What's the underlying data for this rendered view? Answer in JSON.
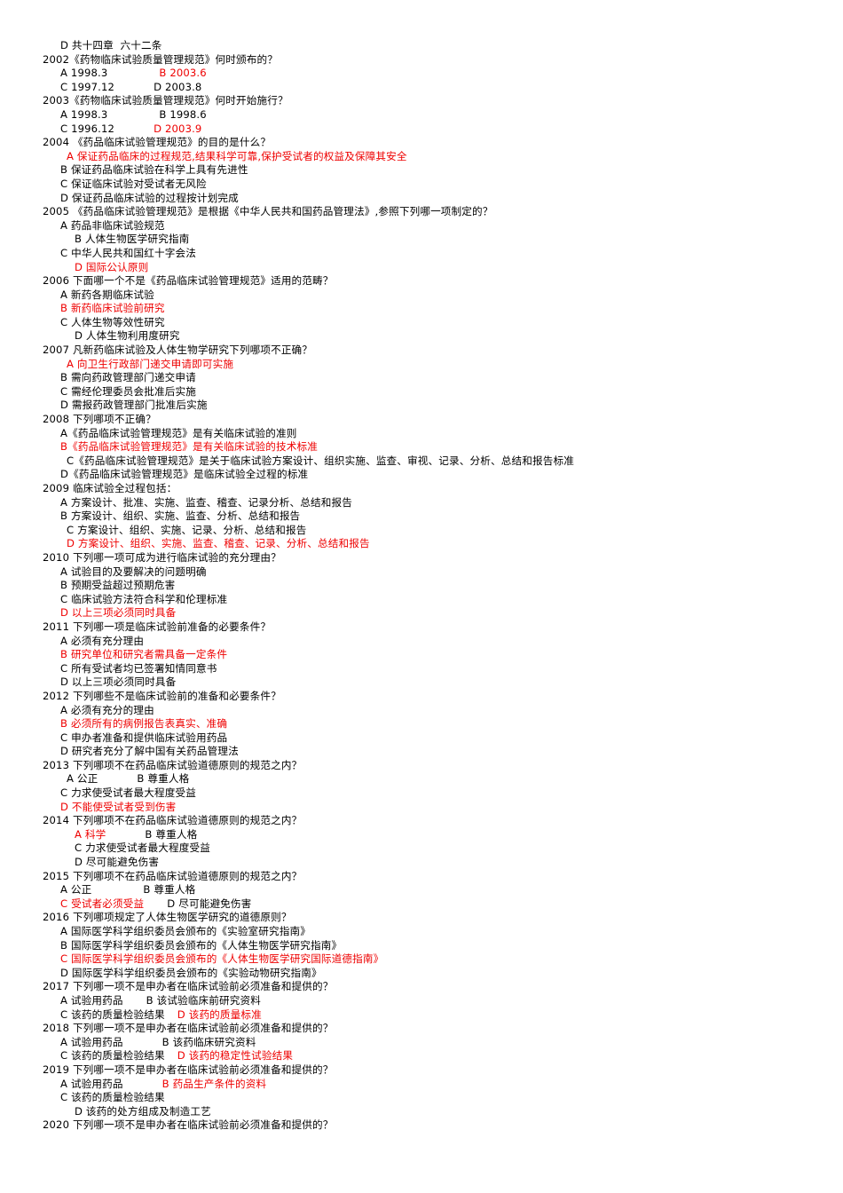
{
  "document": {
    "type": "exam-question-bank",
    "language": "zh-CN",
    "answer_color": "#ee0000",
    "text_color": "#000000",
    "background_color": "#ffffff"
  },
  "lines": [
    {
      "id": "l1",
      "indent": "i-a",
      "segments": [
        {
          "text": "D 共十四章  六十二条",
          "color": "black"
        }
      ]
    },
    {
      "id": "l2",
      "indent": "i-q",
      "segments": [
        {
          "text": "2002《药物临床试验质量管理规范》何时颁布的？",
          "color": "black"
        }
      ]
    },
    {
      "id": "l3",
      "indent": "i-a",
      "segments": [
        {
          "text": "A 1998.3",
          "color": "black"
        },
        {
          "gap": "gap-l"
        },
        {
          "text": "B 2003.6",
          "color": "red"
        }
      ]
    },
    {
      "id": "l4",
      "indent": "i-a",
      "segments": [
        {
          "text": "C 1997.12",
          "color": "black"
        },
        {
          "gap": "gap-m"
        },
        {
          "text": "D 2003.8",
          "color": "black"
        }
      ]
    },
    {
      "id": "l5",
      "indent": "i-q",
      "segments": [
        {
          "text": "2003《药物临床试验质量管理规范》何时开始施行？",
          "color": "black"
        }
      ]
    },
    {
      "id": "l6",
      "indent": "i-a",
      "segments": [
        {
          "text": "A 1998.3",
          "color": "black"
        },
        {
          "gap": "gap-l"
        },
        {
          "text": "B 1998.6",
          "color": "black"
        }
      ]
    },
    {
      "id": "l7",
      "indent": "i-a",
      "segments": [
        {
          "text": "C 1996.12",
          "color": "black"
        },
        {
          "gap": "gap-m"
        },
        {
          "text": "D 2003.9",
          "color": "red"
        }
      ]
    },
    {
      "id": "l8",
      "indent": "i-q",
      "segments": [
        {
          "text": "2004 《药品临床试验管理规范》的目的是什么？",
          "color": "black"
        }
      ]
    },
    {
      "id": "l9",
      "indent": "i-b",
      "segments": [
        {
          "text": "A 保证药品临床的过程规范,结果科学可靠,保护受试者的权益及保障其安全",
          "color": "red"
        }
      ]
    },
    {
      "id": "l10",
      "indent": "i-a",
      "segments": [
        {
          "text": "B 保证药品临床试验在科学上具有先进性",
          "color": "black"
        }
      ]
    },
    {
      "id": "l11",
      "indent": "i-a",
      "segments": [
        {
          "text": "C 保证临床试验对受试者无风险",
          "color": "black"
        }
      ]
    },
    {
      "id": "l12",
      "indent": "i-a",
      "segments": [
        {
          "text": "D 保证药品临床试验的过程按计划完成",
          "color": "black"
        }
      ]
    },
    {
      "id": "l13",
      "indent": "i-q",
      "segments": [
        {
          "text": "2005 《药品临床试验管理规范》是根据《中华人民共和国药品管理法》,参照下列哪一项制定的？",
          "color": "black"
        }
      ]
    },
    {
      "id": "l14",
      "indent": "i-a",
      "segments": [
        {
          "text": "A 药品非临床试验规范",
          "color": "black"
        }
      ]
    },
    {
      "id": "l15",
      "indent": "i-c",
      "segments": [
        {
          "text": "B 人体生物医学研究指南",
          "color": "black"
        }
      ]
    },
    {
      "id": "l16",
      "indent": "i-a",
      "segments": [
        {
          "text": "C 中华人民共和国红十字会法",
          "color": "black"
        }
      ]
    },
    {
      "id": "l17",
      "indent": "i-c",
      "segments": [
        {
          "text": "D 国际公认原则",
          "color": "red"
        }
      ]
    },
    {
      "id": "l18",
      "indent": "i-q",
      "segments": [
        {
          "text": "2006 下面哪一个不是《药品临床试验管理规范》适用的范畴？",
          "color": "black"
        }
      ]
    },
    {
      "id": "l19",
      "indent": "i-a",
      "segments": [
        {
          "text": "A 新药各期临床试验",
          "color": "black"
        }
      ]
    },
    {
      "id": "l20",
      "indent": "i-a",
      "segments": [
        {
          "text": "B 新药临床试验前研究",
          "color": "red"
        }
      ]
    },
    {
      "id": "l21",
      "indent": "i-a",
      "segments": [
        {
          "text": "C 人体生物等效性研究",
          "color": "black"
        }
      ]
    },
    {
      "id": "l22",
      "indent": "i-c",
      "segments": [
        {
          "text": "D 人体生物利用度研究",
          "color": "black"
        }
      ]
    },
    {
      "id": "l23",
      "indent": "i-q",
      "segments": [
        {
          "text": "2007 凡新药临床试验及人体生物学研究下列哪项不正确？",
          "color": "black"
        }
      ]
    },
    {
      "id": "l24",
      "indent": "i-b",
      "segments": [
        {
          "text": "A 向卫生行政部门递交申请即可实施",
          "color": "red"
        }
      ]
    },
    {
      "id": "l25",
      "indent": "i-a",
      "segments": [
        {
          "text": "B 需向药政管理部门递交申请",
          "color": "black"
        }
      ]
    },
    {
      "id": "l26",
      "indent": "i-a",
      "segments": [
        {
          "text": "C 需经伦理委员会批准后实施",
          "color": "black"
        }
      ]
    },
    {
      "id": "l27",
      "indent": "i-a",
      "segments": [
        {
          "text": "D 需报药政管理部门批准后实施",
          "color": "black"
        }
      ]
    },
    {
      "id": "l28",
      "indent": "i-q",
      "segments": [
        {
          "text": "2008 下列哪项不正确？",
          "color": "black"
        }
      ]
    },
    {
      "id": "l29",
      "indent": "i-a",
      "segments": [
        {
          "text": "A《药品临床试验管理规范》是有关临床试验的准则",
          "color": "black"
        }
      ]
    },
    {
      "id": "l30",
      "indent": "i-a",
      "segments": [
        {
          "text": "B《药品临床试验管理规范》是有关临床试验的技术标准",
          "color": "red"
        }
      ]
    },
    {
      "id": "l31",
      "indent": "i-b",
      "segments": [
        {
          "text": "C《药品临床试验管理规范》是关于临床试验方案设计、组织实施、监查、审视、记录、分析、总结和报告标准",
          "color": "black"
        }
      ]
    },
    {
      "id": "l32",
      "indent": "i-a",
      "segments": [
        {
          "text": "D《药品临床试验管理规范》是临床试验全过程的标准",
          "color": "black"
        }
      ]
    },
    {
      "id": "l33",
      "indent": "i-q",
      "segments": [
        {
          "text": "2009 临床试验全过程包括：",
          "color": "black"
        }
      ]
    },
    {
      "id": "l34",
      "indent": "i-a",
      "segments": [
        {
          "text": "A 方案设计、批准、实施、监查、稽查、记录分析、总结和报告",
          "color": "black"
        }
      ]
    },
    {
      "id": "l35",
      "indent": "i-a",
      "segments": [
        {
          "text": "B 方案设计、组织、实施、监查、分析、总结和报告",
          "color": "black"
        }
      ]
    },
    {
      "id": "l36",
      "indent": "i-b",
      "segments": [
        {
          "text": "C 方案设计、组织、实施、记录、分析、总结和报告",
          "color": "black"
        }
      ]
    },
    {
      "id": "l37",
      "indent": "i-b",
      "segments": [
        {
          "text": "D 方案设计、组织、实施、监查、稽查、记录、分析、总结和报告",
          "color": "red"
        }
      ]
    },
    {
      "id": "l38",
      "indent": "i-q",
      "segments": [
        {
          "text": "2010 下列哪一项可成为进行临床试验的充分理由？",
          "color": "black"
        }
      ]
    },
    {
      "id": "l39",
      "indent": "i-a",
      "segments": [
        {
          "text": "A 试验目的及要解决的问题明确",
          "color": "black"
        }
      ]
    },
    {
      "id": "l40",
      "indent": "i-a",
      "segments": [
        {
          "text": "B 预期受益超过预期危害",
          "color": "black"
        }
      ]
    },
    {
      "id": "l41",
      "indent": "i-a",
      "segments": [
        {
          "text": "C 临床试验方法符合科学和伦理标准",
          "color": "black"
        }
      ]
    },
    {
      "id": "l42",
      "indent": "i-a",
      "segments": [
        {
          "text": "D 以上三项必须同时具备",
          "color": "red"
        }
      ]
    },
    {
      "id": "l43",
      "indent": "i-q",
      "segments": [
        {
          "text": "2011 下列哪一项是临床试验前准备的必要条件？",
          "color": "black"
        }
      ]
    },
    {
      "id": "l44",
      "indent": "i-a",
      "segments": [
        {
          "text": "A 必须有充分理由",
          "color": "black"
        }
      ]
    },
    {
      "id": "l45",
      "indent": "i-a",
      "segments": [
        {
          "text": "B 研究单位和研究者需具备一定条件",
          "color": "red"
        }
      ]
    },
    {
      "id": "l46",
      "indent": "i-a",
      "segments": [
        {
          "text": "C 所有受试者均已签署知情同意书",
          "color": "black"
        }
      ]
    },
    {
      "id": "l47",
      "indent": "i-a",
      "segments": [
        {
          "text": "D 以上三项必须同时具备",
          "color": "black"
        }
      ]
    },
    {
      "id": "l48",
      "indent": "i-q",
      "segments": [
        {
          "text": "2012 下列哪些不是临床试验前的准备和必要条件？",
          "color": "black"
        }
      ]
    },
    {
      "id": "l49",
      "indent": "i-a",
      "segments": [
        {
          "text": "A 必须有充分的理由",
          "color": "black"
        }
      ]
    },
    {
      "id": "l50",
      "indent": "i-a",
      "segments": [
        {
          "text": "B 必须所有的病例报告表真实、准确",
          "color": "red"
        }
      ]
    },
    {
      "id": "l51",
      "indent": "i-a",
      "segments": [
        {
          "text": "C 申办者准备和提供临床试验用药品",
          "color": "black"
        }
      ]
    },
    {
      "id": "l52",
      "indent": "i-a",
      "segments": [
        {
          "text": "D 研究者充分了解中国有关药品管理法",
          "color": "black"
        }
      ]
    },
    {
      "id": "l53",
      "indent": "i-q",
      "segments": [
        {
          "text": "2013 下列哪项不在药品临床试验道德原则的规范之内？",
          "color": "black"
        }
      ]
    },
    {
      "id": "l54",
      "indent": "i-b",
      "segments": [
        {
          "text": "A 公正",
          "color": "black"
        },
        {
          "gap": "gap-m"
        },
        {
          "text": "B 尊重人格",
          "color": "black"
        }
      ]
    },
    {
      "id": "l55",
      "indent": "i-a",
      "segments": [
        {
          "text": "C 力求使受试者最大程度受益",
          "color": "black"
        }
      ]
    },
    {
      "id": "l56",
      "indent": "i-a",
      "segments": [
        {
          "text": "D 不能使受试者受到伤害",
          "color": "red"
        }
      ]
    },
    {
      "id": "l57",
      "indent": "i-q",
      "segments": [
        {
          "text": "2014 下列哪项不在药品临床试验道德原则的规范之内？",
          "color": "black"
        }
      ]
    },
    {
      "id": "l58",
      "indent": "i-c",
      "segments": [
        {
          "text": "A 科学",
          "color": "red"
        },
        {
          "gap": "gap-m"
        },
        {
          "text": "B 尊重人格",
          "color": "black"
        }
      ]
    },
    {
      "id": "l59",
      "indent": "i-c",
      "segments": [
        {
          "text": "C 力求使受试者最大程度受益",
          "color": "black"
        }
      ]
    },
    {
      "id": "l60",
      "indent": "i-c",
      "segments": [
        {
          "text": "D 尽可能避免伤害",
          "color": "black"
        }
      ]
    },
    {
      "id": "l61",
      "indent": "i-q",
      "segments": [
        {
          "text": "2015 下列哪项不在药品临床试验道德原则的规范之内？",
          "color": "black"
        }
      ]
    },
    {
      "id": "l62",
      "indent": "i-a",
      "segments": [
        {
          "text": "A 公正",
          "color": "black"
        },
        {
          "gap": "gap-l"
        },
        {
          "text": "B 尊重人格",
          "color": "black"
        }
      ]
    },
    {
      "id": "l63",
      "indent": "i-a",
      "segments": [
        {
          "text": "C 受试者必须受益",
          "color": "red"
        },
        {
          "gap": "gap-s"
        },
        {
          "text": "D 尽可能避免伤害",
          "color": "black"
        }
      ]
    },
    {
      "id": "l64",
      "indent": "i-q",
      "segments": [
        {
          "text": "2016 下列哪项规定了人体生物医学研究的道德原则？",
          "color": "black"
        }
      ]
    },
    {
      "id": "l65",
      "indent": "i-a",
      "segments": [
        {
          "text": "A 国际医学科学组织委员会颁布的《实验室研究指南》",
          "color": "black"
        }
      ]
    },
    {
      "id": "l66",
      "indent": "i-a",
      "segments": [
        {
          "text": "B 国际医学科学组织委员会颁布的《人体生物医学研究指南》",
          "color": "black"
        }
      ]
    },
    {
      "id": "l67",
      "indent": "i-a",
      "segments": [
        {
          "text": "C 国际医学科学组织委员会颁布的《人体生物医学研究国际道德指南》",
          "color": "red"
        }
      ]
    },
    {
      "id": "l68",
      "indent": "i-a",
      "segments": [
        {
          "text": "D 国际医学科学组织委员会颁布的《实验动物研究指南》",
          "color": "black"
        }
      ]
    },
    {
      "id": "l69",
      "indent": "i-q",
      "segments": [
        {
          "text": "2017 下列哪一项不是申办者在临床试验前必须准备和提供的？",
          "color": "black"
        }
      ]
    },
    {
      "id": "l70",
      "indent": "i-a",
      "segments": [
        {
          "text": "A 试验用药品",
          "color": "black"
        },
        {
          "gap": "gap-s"
        },
        {
          "text": "B 该试验临床前研究资料",
          "color": "black"
        }
      ]
    },
    {
      "id": "l71",
      "indent": "i-a",
      "segments": [
        {
          "text": "C 该药的质量检验结果",
          "color": "black"
        },
        {
          "gap": "gap-xs"
        },
        {
          "text": "D 该药的质量标准",
          "color": "red"
        }
      ]
    },
    {
      "id": "l72",
      "indent": "i-q",
      "segments": [
        {
          "text": "2018 下列哪一项不是申办者在临床试验前必须准备和提供的？",
          "color": "black"
        }
      ]
    },
    {
      "id": "l73",
      "indent": "i-a",
      "segments": [
        {
          "text": "A 试验用药品",
          "color": "black"
        },
        {
          "gap": "gap-m"
        },
        {
          "text": "B 该药临床研究资料",
          "color": "black"
        }
      ]
    },
    {
      "id": "l74",
      "indent": "i-a",
      "segments": [
        {
          "text": "C 该药的质量检验结果",
          "color": "black"
        },
        {
          "gap": "gap-xs"
        },
        {
          "text": "D 该药的稳定性试验结果",
          "color": "red"
        }
      ]
    },
    {
      "id": "l75",
      "indent": "i-q",
      "segments": [
        {
          "text": "2019 下列哪一项不是申办者在临床试验前必须准备和提供的？",
          "color": "black"
        }
      ]
    },
    {
      "id": "l76",
      "indent": "i-a",
      "segments": [
        {
          "text": "A 试验用药品",
          "color": "black"
        },
        {
          "gap": "gap-m"
        },
        {
          "text": "B 药品生产条件的资料",
          "color": "red"
        }
      ]
    },
    {
      "id": "l77",
      "indent": "i-a",
      "segments": [
        {
          "text": "C 该药的质量检验结果",
          "color": "black"
        }
      ]
    },
    {
      "id": "l78",
      "indent": "i-c",
      "segments": [
        {
          "text": "D 该药的处方组成及制造工艺",
          "color": "black"
        }
      ]
    },
    {
      "id": "l79",
      "indent": "i-q",
      "segments": [
        {
          "text": "2020 下列哪一项不是申办者在临床试验前必须准备和提供的？",
          "color": "black"
        }
      ]
    }
  ]
}
